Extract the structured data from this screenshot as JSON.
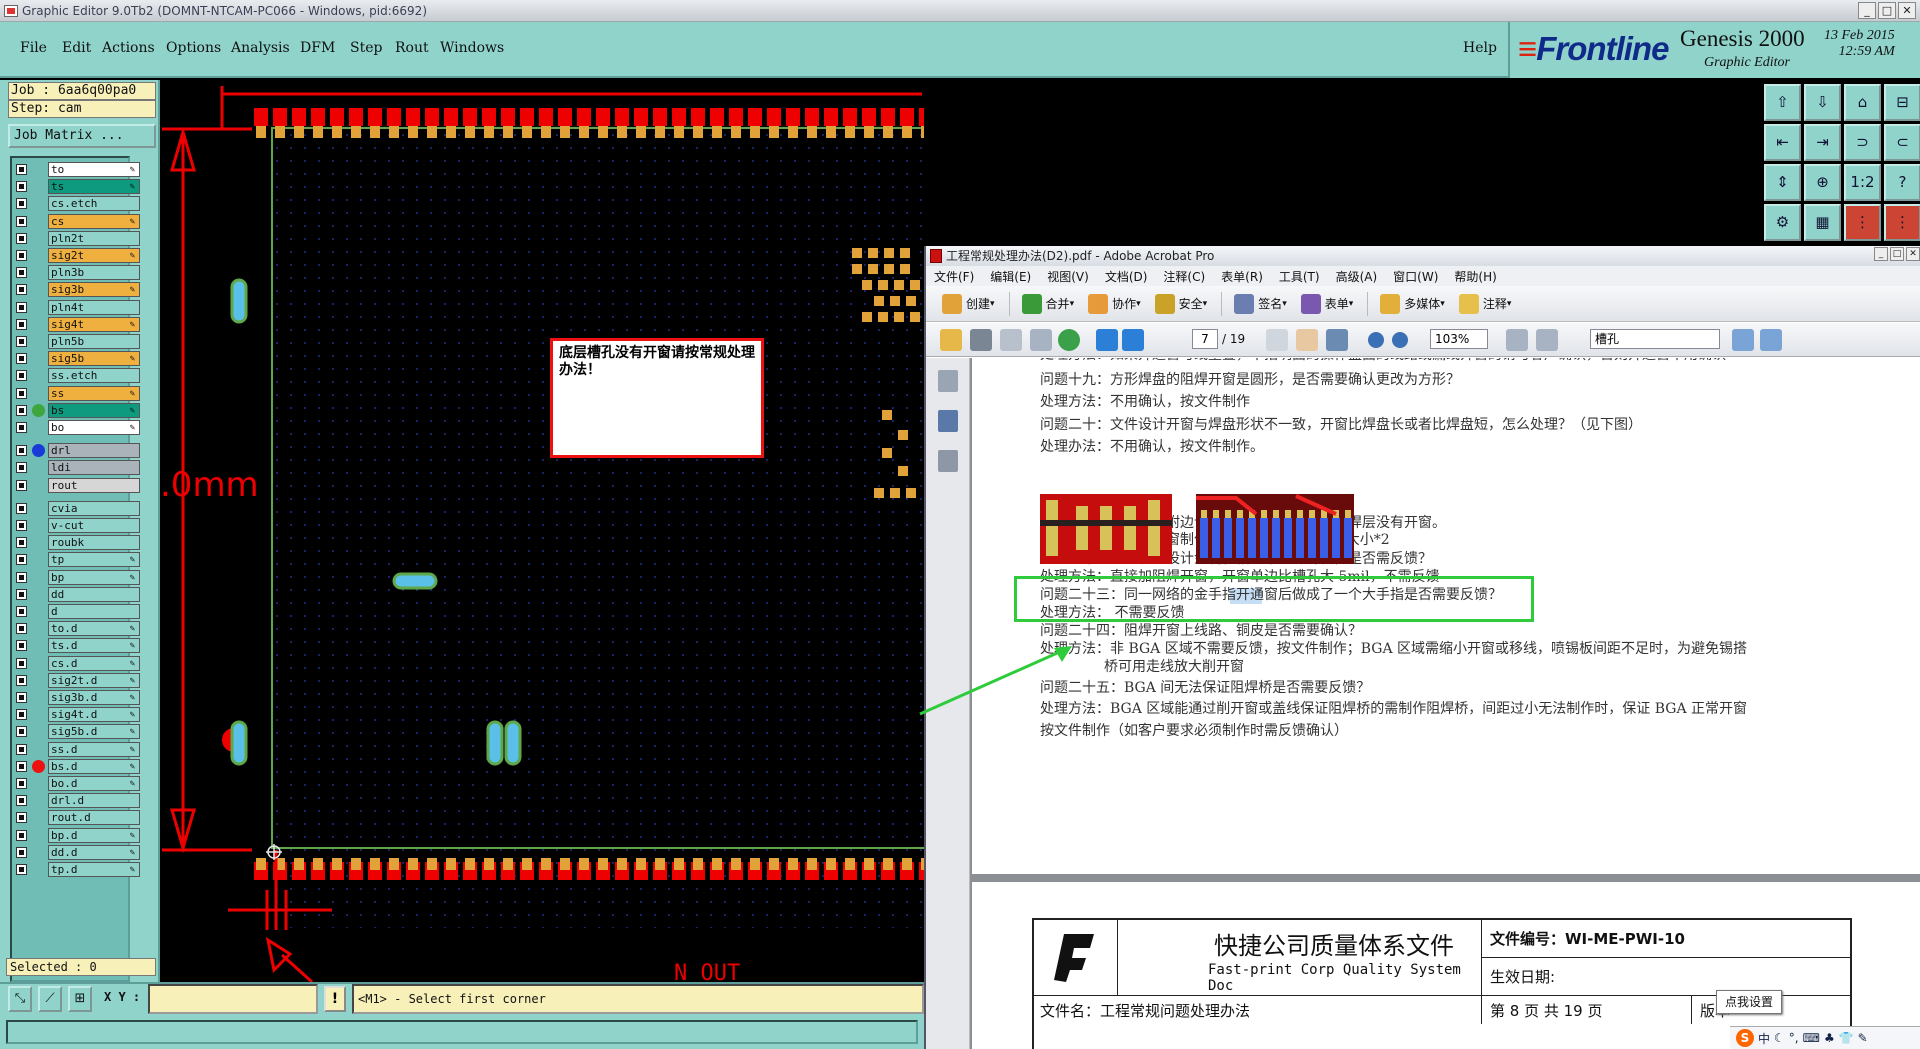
{
  "genesis": {
    "title": "Graphic Editor 9.0Tb2 (DOMNT-NTCAM-PC066 - Windows, pid:6692)",
    "menu": [
      "File",
      "Edit",
      "Actions",
      "Options",
      "Analysis",
      "DFM",
      "Step",
      "Rout",
      "Windows"
    ],
    "help": "Help",
    "brand": {
      "logo": "Frontline",
      "product": "Genesis 2000",
      "subtitle": "Graphic Editor",
      "date": "13 Feb 2015",
      "time": "12:59 AM"
    },
    "job": "Job : 6aa6q00pa0",
    "step": "Step: cam",
    "job_matrix": "Job Matrix ...",
    "layers": [
      {
        "name": "to",
        "color": "#ffffff",
        "dot": "",
        "pen": true
      },
      {
        "name": "ts",
        "color": "#0e9a7e",
        "dot": "",
        "pen": true
      },
      {
        "name": "cs.etch",
        "color": "#8fd3cb",
        "dot": "",
        "pen": false
      },
      {
        "name": "cs",
        "color": "#f0b040",
        "dot": "",
        "pen": true
      },
      {
        "name": "pln2t",
        "color": "#8fd3cb",
        "dot": "",
        "pen": false
      },
      {
        "name": "sig2t",
        "color": "#f0b040",
        "dot": "",
        "pen": true
      },
      {
        "name": "pln3b",
        "color": "#8fd3cb",
        "dot": "",
        "pen": false
      },
      {
        "name": "sig3b",
        "color": "#f0b040",
        "dot": "",
        "pen": true
      },
      {
        "name": "pln4t",
        "color": "#8fd3cb",
        "dot": "",
        "pen": false
      },
      {
        "name": "sig4t",
        "color": "#f0b040",
        "dot": "",
        "pen": true
      },
      {
        "name": "pln5b",
        "color": "#8fd3cb",
        "dot": "",
        "pen": false
      },
      {
        "name": "sig5b",
        "color": "#f0b040",
        "dot": "",
        "pen": true
      },
      {
        "name": "ss.etch",
        "color": "#8fd3cb",
        "dot": "",
        "pen": false
      },
      {
        "name": "ss",
        "color": "#f0b040",
        "dot": "",
        "pen": true
      },
      {
        "name": "bs",
        "color": "#0e9a7e",
        "dot": "#3da63d",
        "pen": true
      },
      {
        "name": "bo",
        "color": "#ffffff",
        "dot": "",
        "pen": true
      },
      {
        "name": "drl",
        "color": "#a9b3b9",
        "dot": "#1a3ad8",
        "pen": false
      },
      {
        "name": "ldi",
        "color": "#a9b3b9",
        "dot": "",
        "pen": false
      },
      {
        "name": "rout",
        "color": "#d6d6d6",
        "dot": "",
        "pen": false
      },
      {
        "name": "cvia",
        "color": "#8fd3cb",
        "dot": "",
        "pen": false
      },
      {
        "name": "v-cut",
        "color": "#8fd3cb",
        "dot": "",
        "pen": false
      },
      {
        "name": "roubk",
        "color": "#8fd3cb",
        "dot": "",
        "pen": false
      },
      {
        "name": "tp",
        "color": "#8fd3cb",
        "dot": "",
        "pen": true
      },
      {
        "name": "bp",
        "color": "#8fd3cb",
        "dot": "",
        "pen": true
      },
      {
        "name": "dd",
        "color": "#8fd3cb",
        "dot": "",
        "pen": false
      },
      {
        "name": "d",
        "color": "#8fd3cb",
        "dot": "",
        "pen": false
      },
      {
        "name": "to.d",
        "color": "#8fd3cb",
        "dot": "",
        "pen": true
      },
      {
        "name": "ts.d",
        "color": "#8fd3cb",
        "dot": "",
        "pen": true
      },
      {
        "name": "cs.d",
        "color": "#8fd3cb",
        "dot": "",
        "pen": true
      },
      {
        "name": "sig2t.d",
        "color": "#8fd3cb",
        "dot": "",
        "pen": true
      },
      {
        "name": "sig3b.d",
        "color": "#8fd3cb",
        "dot": "",
        "pen": true
      },
      {
        "name": "sig4t.d",
        "color": "#8fd3cb",
        "dot": "",
        "pen": true
      },
      {
        "name": "sig5b.d",
        "color": "#8fd3cb",
        "dot": "",
        "pen": true
      },
      {
        "name": "ss.d",
        "color": "#8fd3cb",
        "dot": "",
        "pen": true
      },
      {
        "name": "bs.d",
        "color": "#8fd3cb",
        "dot": "#e11",
        "pen": true
      },
      {
        "name": "bo.d",
        "color": "#8fd3cb",
        "dot": "",
        "pen": true
      },
      {
        "name": "drl.d",
        "color": "#8fd3cb",
        "dot": "",
        "pen": false
      },
      {
        "name": "rout.d",
        "color": "#8fd3cb",
        "dot": "",
        "pen": false
      },
      {
        "name": "bp.d",
        "color": "#8fd3cb",
        "dot": "",
        "pen": true
      },
      {
        "name": "dd.d",
        "color": "#8fd3cb",
        "dot": "",
        "pen": true
      },
      {
        "name": "tp.d",
        "color": "#8fd3cb",
        "dot": "",
        "pen": true
      }
    ],
    "selected": "Selected : 0",
    "xy_label": "X Y :",
    "xy_value": "",
    "excl": "!",
    "message": "<M1> - Select first corner",
    "dimension_text": ".0mm",
    "note": "底层槽孔没有开窗请按常规处理办法！",
    "partial_bottom_text": "N  OUT"
  },
  "acrobat": {
    "title": "工程常规处理办法(D2).pdf - Adobe Acrobat Pro",
    "menu": [
      "文件(F)",
      "编辑(E)",
      "视图(V)",
      "文档(D)",
      "注释(C)",
      "表单(R)",
      "工具(T)",
      "高级(A)",
      "窗口(W)",
      "帮助(H)"
    ],
    "toolbar": [
      "创建",
      "合并",
      "协作",
      "安全",
      "签名",
      "表单",
      "多媒体",
      "注释"
    ],
    "page_current": "7",
    "page_total": "/ 19",
    "zoom": "103%",
    "find": "槽孔",
    "lines": [
      "处理方法：如果开通窗与线重叠，不指明面的操作盘面的线路或漏线开窗的请与客户确认，否则开通窗不用确认",
      "问题十九：方形焊盘的阻焊开窗是圆形，是否需要确认更改为方形？",
      "处理方法：不用确认，按文件制作",
      "问题二十：文件设计开窗与焊盘形状不一致，开窗比焊盘长或者比焊盘短，怎么处理？（见下图）",
      "处理办法：不用确认，按文件制作。",
      "问题二十一：客户在附边设计了反光点，但是在阻焊层没有开窗。",
      "处理办法：直接加开窗制作，开窗大小=反光点的大小*2",
      "问题二十二：如客户设计金属化槽孔未阻焊开窗，是否需反馈？",
      "处理方法：直接加阻焊开窗，开窗单边比槽孔大 5mil，不需反馈",
      "问题二十三：同一网络的金手指开通窗后做成了一个大手指是否需要反馈？",
      "处理方法： 不需要反馈",
      "问题二十四：阻焊开窗上线路、铜皮是否需要确认？",
      "处理方法：非 BGA 区域不需要反馈，按文件制作；BGA 区域需缩小开窗或移线，喷锡板间距不足时，为避免锡搭",
      "桥可用走线放大削开窗",
      "问题二十五：BGA 间无法保证阻焊桥是否需要反馈？",
      "处理方法：BGA 区域能通过削开窗或盖线保证阻焊桥的需制作阻焊桥，间距过小无法制作时，保证 BGA 正常开窗",
      "按文件制作（如客户要求必须制作时需反馈确认）"
    ],
    "doc_header": {
      "company_cn": "快捷公司质量体系文件",
      "company_en": "Fast-print Corp Quality System Doc",
      "doc_no_label": "文件编号：WI-ME-PWI-10",
      "effective_label": "生效日期:",
      "file_name": "文件名：工程常规问题处理办法",
      "page_info": "第 8 页 共 19 页",
      "version": "版本"
    }
  },
  "taskbar": {
    "tooltip": "点我设置",
    "ime": "中"
  }
}
